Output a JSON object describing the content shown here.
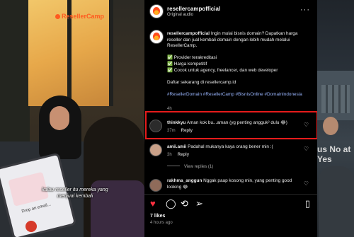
{
  "video": {
    "brand_logo": "ResellerCamp",
    "caption": "kalau reseller itu mereka yang menjual kembali",
    "tablet_text": "Drop an email..."
  },
  "header": {
    "username": "resellercampofficial",
    "subtitle": "Original audio",
    "more": "···"
  },
  "post_caption": {
    "username": "resellercampofficial",
    "line1": "Ingin mulai bisnis domain? Dapatkan harga reseller dan jual kembali domain dengan lebih mudah melalui ResellerCamp.",
    "bullets": [
      "✅ Provider terakreditasi",
      "✅ Harga kompetitif",
      "✅ Cocok untuk agency, freelancer, dan web developer"
    ],
    "cta": "Daftar sekarang di resellercamp.id",
    "hashtags": "#ResellerDomain #ResellerCamp #BisnisOnline #DomainIndonesia",
    "time": "4h"
  },
  "comments": [
    {
      "username": "thinkkyu",
      "text": "Aman kok bu...aman (yg penting angguk² dulu 😂)",
      "time": "37m",
      "reply": "Reply"
    },
    {
      "username": "amii.amii",
      "text": "Padahal mukanya kaya orang bener min :(",
      "time": "3h",
      "reply": "Reply"
    },
    {
      "username": "rakhma_anggun",
      "text": "Nggak paap kosong min, yang penting good looking 😂",
      "time": "",
      "reply": ""
    }
  ],
  "view_replies": "View replies (1)",
  "footer": {
    "likes": "7 likes",
    "ago": "4 hours ago"
  },
  "peek": {
    "text": "us No at Yes"
  },
  "colors": {
    "highlight": "#e51b1b",
    "hashtag": "#9ab6ff",
    "like_red": "#ff3040"
  }
}
